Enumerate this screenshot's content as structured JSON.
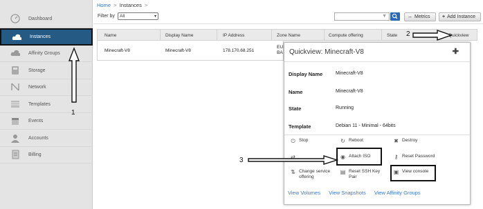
{
  "sidebar": {
    "items": [
      {
        "label": "Dashboard",
        "icon": "dashboard-icon"
      },
      {
        "label": "Instances",
        "icon": "cloud-icon"
      },
      {
        "label": "Affinity Groups",
        "icon": "cloud-group-icon"
      },
      {
        "label": "Storage",
        "icon": "storage-icon"
      },
      {
        "label": "Network",
        "icon": "network-icon"
      },
      {
        "label": "Templates",
        "icon": "templates-icon"
      },
      {
        "label": "Events",
        "icon": "calendar-icon"
      },
      {
        "label": "Accounts",
        "icon": "user-icon"
      },
      {
        "label": "Billing",
        "icon": "document-icon"
      }
    ]
  },
  "breadcrumb": {
    "home": "Home",
    "sep": ">",
    "current": "Instances"
  },
  "filter": {
    "label": "Filter by",
    "selected": "All"
  },
  "toolbar": {
    "metrics_label": "Metrics",
    "add_label": "Add Instance"
  },
  "table": {
    "columns": [
      "Name",
      "Display Name",
      "IP Address",
      "Zone Name",
      "Compute offering",
      "State",
      "Quickview"
    ],
    "row": {
      "name": "Minecraft-V8",
      "display_name": "Minecraft-V8",
      "ip": "178.170.68.251",
      "zone_line1": "EU",
      "zone_line2": "BA"
    }
  },
  "quickview": {
    "title": "Quickview: Minecraft-V8",
    "details": [
      {
        "key": "Display Name",
        "value": "Minecraft-V8"
      },
      {
        "key": "Name",
        "value": "Minecraft-V8"
      },
      {
        "key": "State",
        "value": "Running"
      },
      {
        "key": "Template",
        "value": "Debian 11 - Minimal - 64bits"
      }
    ],
    "actions": {
      "stop": "Stop",
      "reboot": "Reboot",
      "destroy": "Destroy",
      "attach_iso": "Attach ISO",
      "reset_password": "Reset Password",
      "change_service_1": "Change service",
      "change_service_2": "offering",
      "reset_ssh_1": "Reset SSH Key",
      "reset_ssh_2": "Pair",
      "view_console": "View console"
    },
    "links": {
      "volumes": "View Volumes",
      "snapshots": "View Snapshots",
      "affinity": "View Affinity Groups"
    }
  },
  "annotations": {
    "one": "1",
    "two": "2",
    "three": "3"
  },
  "colors": {
    "sidebar_active": "#255a85",
    "accent_link": "#3a78c4",
    "search_button": "#2d69b5"
  }
}
